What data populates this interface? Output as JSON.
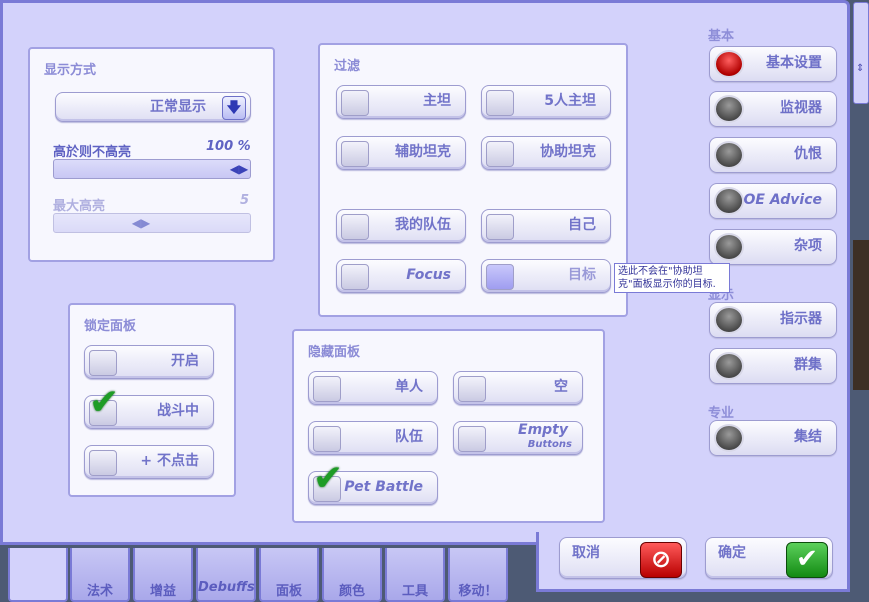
{
  "display_panel": {
    "title": "显示方式",
    "mode_select": "正常显示",
    "threshold_label": "高於则不高亮",
    "threshold_value": "100 %",
    "max_label": "最大高亮",
    "max_value": "5"
  },
  "filter_panel": {
    "title": "过滤",
    "items": [
      {
        "label": "主坦",
        "checked": false
      },
      {
        "label": "5人主坦",
        "checked": false
      },
      {
        "label": "辅助坦克",
        "checked": false
      },
      {
        "label": "协助坦克",
        "checked": false
      },
      {
        "label": "我的队伍",
        "checked": false
      },
      {
        "label": "自己",
        "checked": false
      },
      {
        "label": "Focus",
        "checked": false
      },
      {
        "label": "目标",
        "checked": false
      }
    ]
  },
  "lock_panel": {
    "title": "锁定面板",
    "items": [
      {
        "label": "开启",
        "checked": false
      },
      {
        "label": "战斗中",
        "checked": true
      },
      {
        "label": "+ 不点击",
        "checked": false
      }
    ]
  },
  "hide_panel": {
    "title": "隐藏面板",
    "items": [
      {
        "label": "单人",
        "checked": false
      },
      {
        "label": "空",
        "checked": false
      },
      {
        "label": "队伍",
        "checked": false
      },
      {
        "label": "Empty",
        "checked": false
      },
      {
        "label": "Pet Battle",
        "checked": true
      }
    ],
    "empty_sublabel": "Buttons"
  },
  "tooltip": "选此不会在\"协助坦克\"面板显示你的目标.",
  "sidebar": {
    "cat_basic": "基本",
    "cat_hidden": "显示",
    "cat_pro": "专业",
    "items": [
      {
        "label": "基本设置",
        "active": true
      },
      {
        "label": "监视器",
        "active": false
      },
      {
        "label": "仇恨",
        "active": false
      },
      {
        "label": "AOE Advice",
        "active": false
      },
      {
        "label": "杂项",
        "active": false
      },
      {
        "label": "指示器",
        "active": false
      },
      {
        "label": "群集",
        "active": false
      },
      {
        "label": "集结",
        "active": false
      }
    ]
  },
  "tabs": [
    "",
    "法术",
    "增益",
    "Debuffs",
    "面板",
    "颜色",
    "工具",
    "移动！"
  ],
  "footer": {
    "cancel": "取消",
    "ok": "确定"
  },
  "colors": {
    "frame": "#d3d2fb",
    "border": "#7a7ad6",
    "accent": "#7173c9",
    "check": "#1e9c26"
  }
}
